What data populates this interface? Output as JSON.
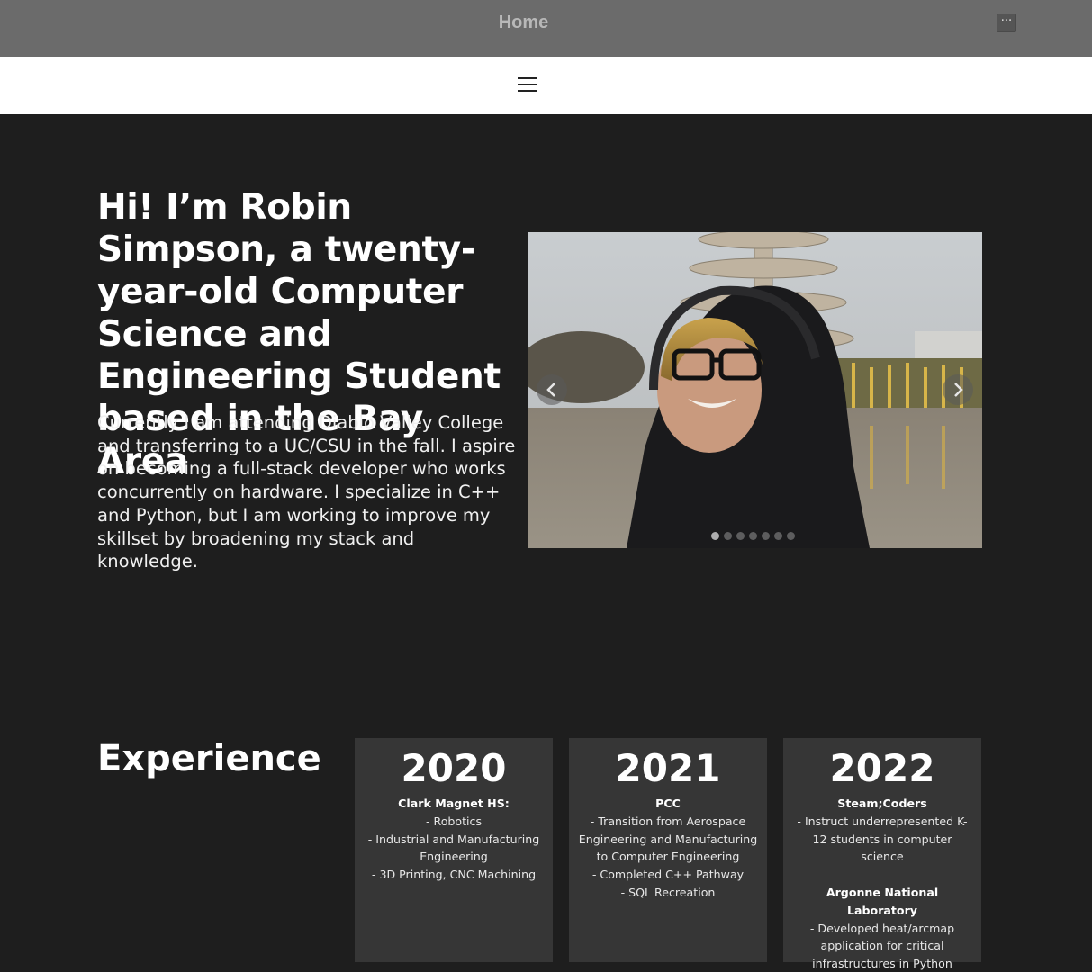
{
  "topbar": {
    "title": "Home",
    "more_label": "···"
  },
  "hero": {
    "heading": "Hi! I’m Robin Simpson, a twenty-year-old Computer Science and Engineering Student based in the Bay Area",
    "intro": "Currently I am attending Diablo Valley College and transferring to a UC/CSU in the fall. I aspire on becoming a full-stack developer who works concurrently on hardware. I specialize in C++ and Python, but I am working to improve my skillset by broadening my stack and knowledge."
  },
  "carousel": {
    "slide_count": 7,
    "active_index": 0,
    "icons": {
      "prev": "chevron-left-icon",
      "next": "chevron-right-icon"
    }
  },
  "experience": {
    "title": "Experience",
    "cards": [
      {
        "year": "2020",
        "entries": [
          {
            "org": "Clark Magnet HS:",
            "lines": [
              "- Robotics",
              "- Industrial and Manufacturing Engineering",
              "- 3D Printing, CNC Machining"
            ]
          }
        ]
      },
      {
        "year": "2021",
        "entries": [
          {
            "org": "PCC",
            "lines": [
              "- Transition from Aerospace Engineering and Manufacturing to Computer Engineering",
              "- Completed C++ Pathway",
              "- SQL Recreation"
            ]
          }
        ]
      },
      {
        "year": "2022",
        "entries": [
          {
            "org": "Steam;Coders",
            "lines": [
              "- Instruct underrepresented K-12 students in computer science"
            ]
          },
          {
            "org": "Argonne National Laboratory",
            "lines": [
              "- Developed heat/arcmap application for critical infrastructures in Python"
            ]
          }
        ]
      }
    ]
  },
  "colors": {
    "page_bg": "#1e1e1e",
    "topbar_bg": "#6b6b6b",
    "card_bg": "#363636",
    "nav_bg": "#ffffff"
  }
}
